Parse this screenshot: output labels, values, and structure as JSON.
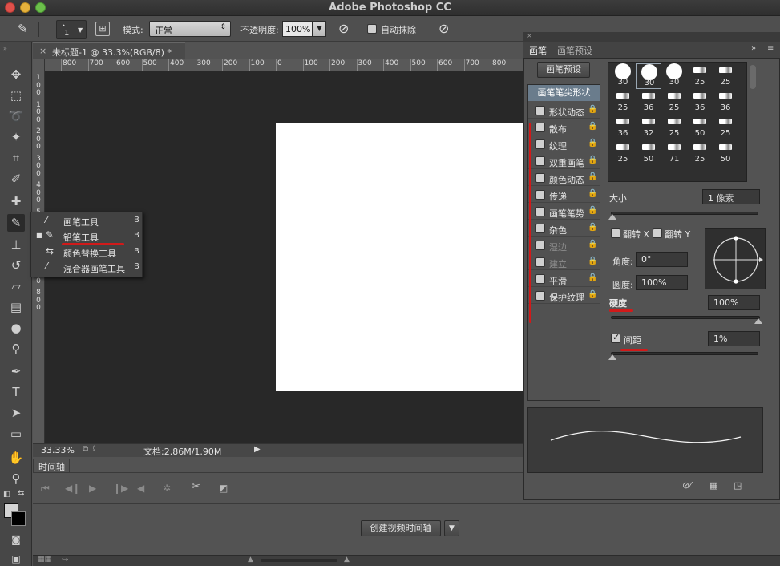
{
  "app": {
    "title": "Adobe Photoshop CC"
  },
  "options_bar": {
    "size_value": "1",
    "mode_label": "模式:",
    "mode_value": "正常",
    "opacity_label": "不透明度:",
    "opacity_value": "100%",
    "auto_erase_label": "自动抹除"
  },
  "document": {
    "tab_close": "×",
    "tab_title": "未标题-1 @ 33.3%(RGB/8) *",
    "ruler_h": [
      "800",
      "700",
      "600",
      "500",
      "400",
      "300",
      "200",
      "100",
      "0",
      "100",
      "200",
      "300",
      "400",
      "500",
      "600",
      "700",
      "800"
    ],
    "ruler_v": [
      "1",
      "0",
      "0",
      "1",
      "0",
      "0",
      "2",
      "0",
      "0",
      "3",
      "0",
      "0",
      "4",
      "0",
      "0",
      "5",
      "0",
      "0",
      "6",
      "0",
      "0",
      "7",
      "0",
      "0",
      "8",
      "0",
      "0"
    ]
  },
  "status": {
    "zoom": "33.33%",
    "doc_info": "文档:2.86M/1.90M"
  },
  "timeline": {
    "tab_label": "时间轴",
    "create_button": "创建视频时间轴"
  },
  "flyout": {
    "items": [
      {
        "label": "画笔工具",
        "key": "B",
        "selected": false
      },
      {
        "label": "铅笔工具",
        "key": "B",
        "selected": true
      },
      {
        "label": "颜色替换工具",
        "key": "B",
        "selected": false
      },
      {
        "label": "混合器画笔工具",
        "key": "B",
        "selected": false
      }
    ]
  },
  "brush_panel": {
    "tabs": [
      "画笔",
      "画笔预设"
    ],
    "preset_button": "画笔预设",
    "tip_shape_header": "画笔笔尖形状",
    "properties": [
      {
        "label": "形状动态",
        "enabled": true
      },
      {
        "label": "散布",
        "enabled": true
      },
      {
        "label": "纹理",
        "enabled": true
      },
      {
        "label": "双重画笔",
        "enabled": true
      },
      {
        "label": "颜色动态",
        "enabled": true
      },
      {
        "label": "传递",
        "enabled": true
      },
      {
        "label": "画笔笔势",
        "enabled": true
      },
      {
        "label": "杂色",
        "enabled": true
      },
      {
        "label": "湿边",
        "enabled": false
      },
      {
        "label": "建立",
        "enabled": false
      },
      {
        "label": "平滑",
        "enabled": true
      },
      {
        "label": "保护纹理",
        "enabled": true
      }
    ],
    "brush_sizes": [
      "30",
      "30",
      "30",
      "25",
      "25",
      "25",
      "36",
      "25",
      "36",
      "36",
      "36",
      "32",
      "25",
      "50",
      "25",
      "25",
      "50",
      "71",
      "25",
      "50"
    ],
    "size_label": "大小",
    "size_value": "1 像素",
    "flip_x_label": "翻转 X",
    "flip_y_label": "翻转 Y",
    "angle_label": "角度:",
    "angle_value": "0°",
    "roundness_label": "圆度:",
    "roundness_value": "100%",
    "hardness_label": "硬度",
    "hardness_value": "100%",
    "spacing_label": "间距",
    "spacing_value": "1%"
  },
  "colors": {
    "annotation_red": "#d11a1a",
    "tip_header": "#6a7c8c"
  }
}
